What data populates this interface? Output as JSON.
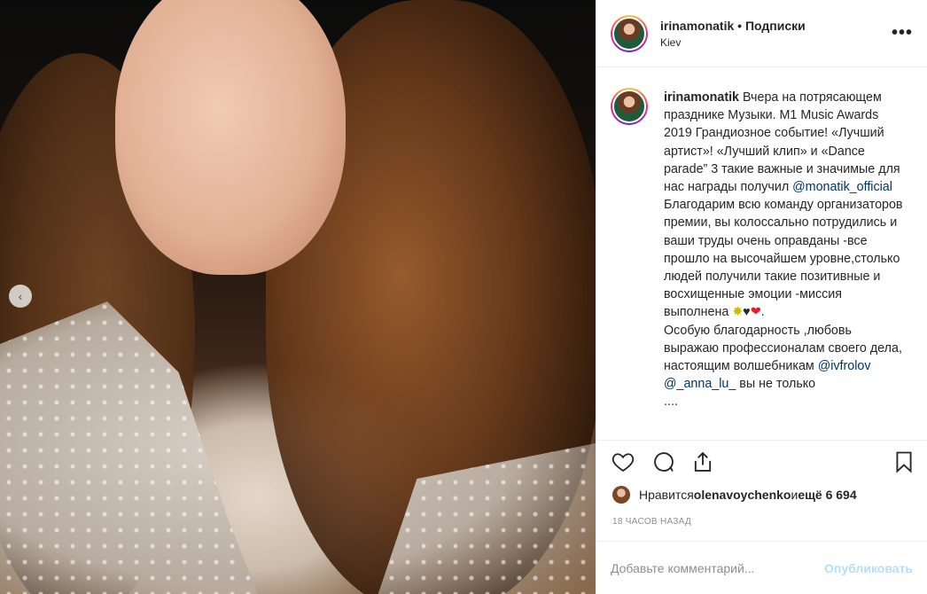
{
  "post": {
    "username": "irinamonatik",
    "separator": "•",
    "follow_label": "Подписки",
    "location": "Kiev",
    "more_label": "•••",
    "carousel_indicator": "‹"
  },
  "caption": {
    "username": "irinamonatik",
    "text_1": " Вчера на потрясающем празднике Музыки. М1 Music Awards 2019 Грандиозное событие! «Лучший артист»! «Лучший клип» и «Dance parade” 3 такие важные и значимые для нас награды получил ",
    "mention_1": "@monatik_official",
    "text_2": "Благодарим всю команду организаторов премии, вы колоссально потрудились и ваши труды очень оправданы -все прошло на высочайшем уровне,столько людей получили такие позитивные и восхищенные эмоции -миссия выполнена ",
    "emoji_star": "✸",
    "emoji_heart_black": "♥",
    "emoji_heart_red": "❤",
    "text_3": ".",
    "text_4": "Особую благодарность ,любовь выражаю профессионалам своего дела, настоящим волшебникам ",
    "mention_2": "@ivfrolov",
    "mention_3": "@_anna_lu_",
    "text_5": " вы не только",
    "text_6": "...."
  },
  "actions": {
    "like_icon": "heart-outline-icon",
    "comment_icon": "comment-bubble-icon",
    "share_icon": "share-icon",
    "save_icon": "bookmark-icon"
  },
  "likes": {
    "prefix": "Нравится ",
    "user": "olenavoychenko",
    "middle": " и ",
    "count": "ещё 6 694"
  },
  "timestamp": "18 ЧАСОВ НАЗАД",
  "comment": {
    "placeholder": "Добавьте комментарий...",
    "publish_label": "Опубликовать"
  }
}
